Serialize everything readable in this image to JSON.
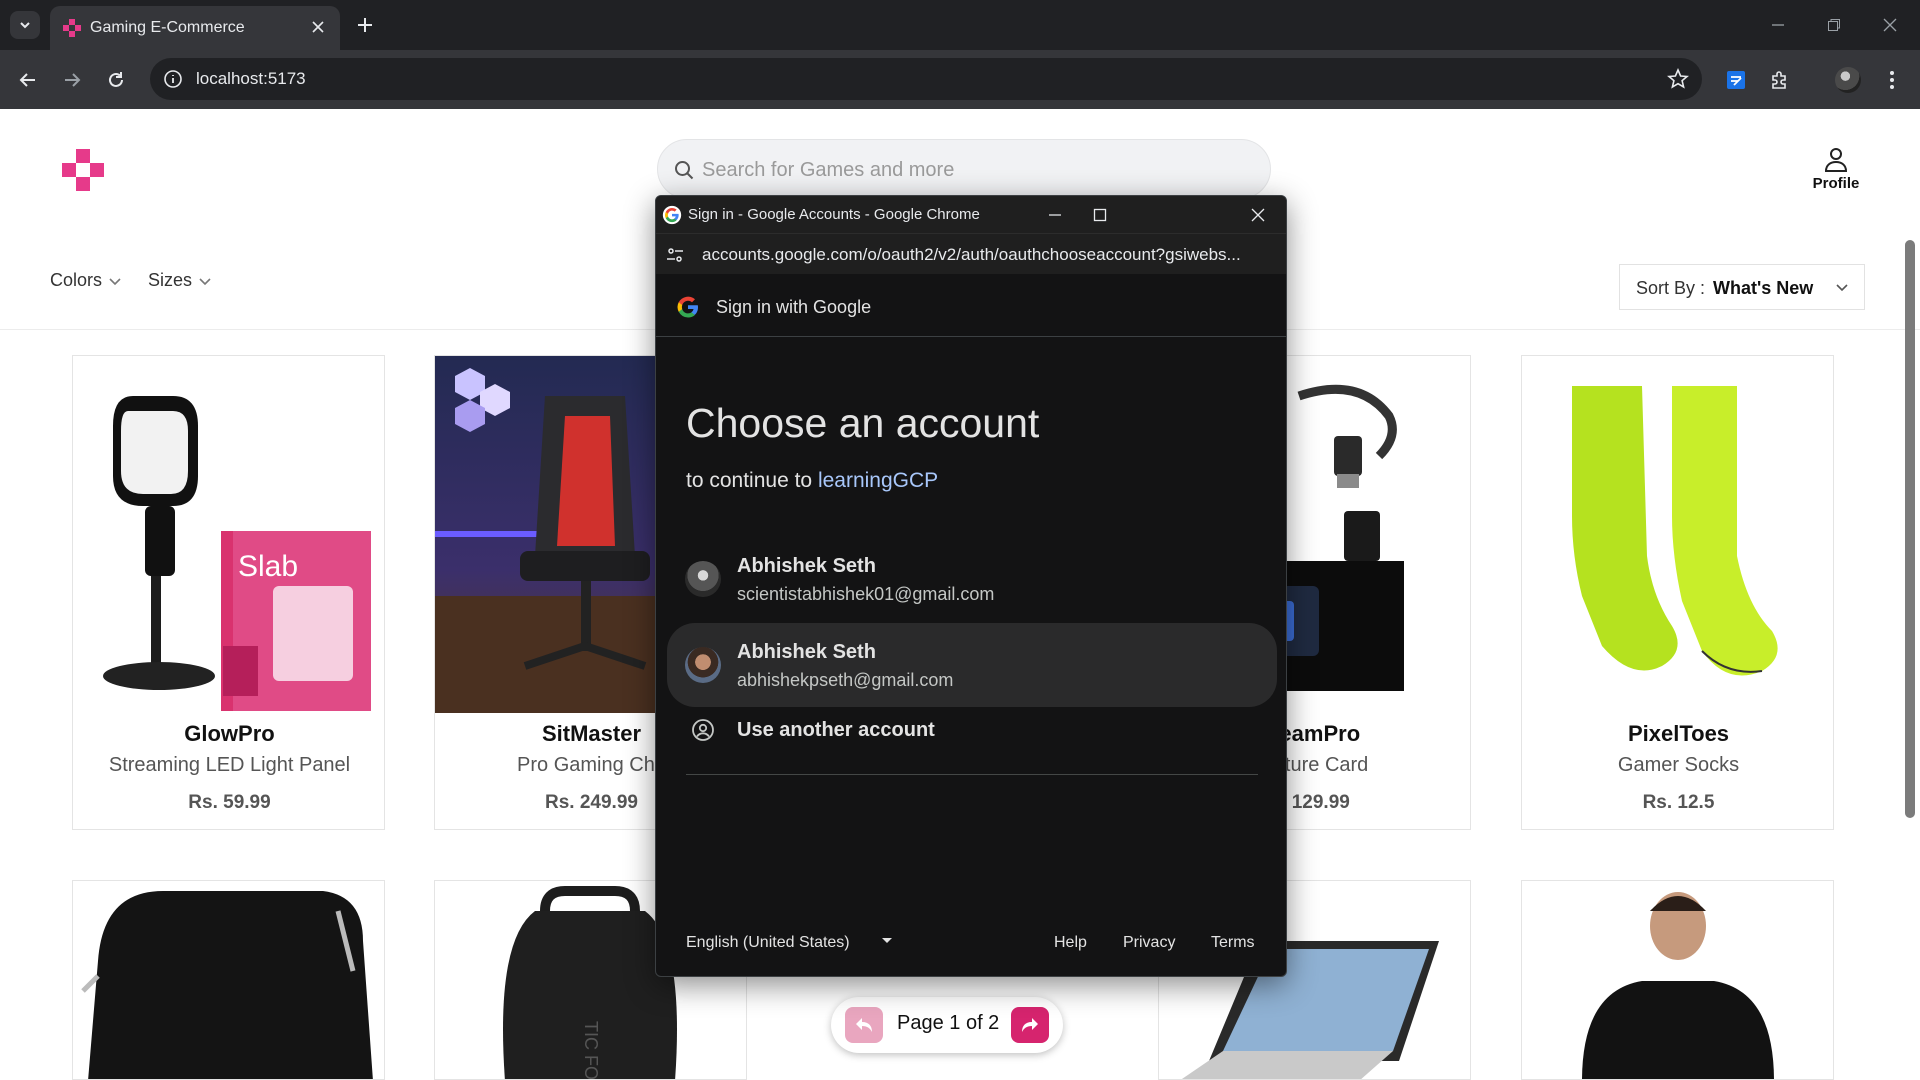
{
  "browser": {
    "tab_title": "Gaming E-Commerce",
    "url": "localhost:5173"
  },
  "site": {
    "search_placeholder": "Search for Games and more",
    "profile_label": "Profile",
    "filters": [
      "Colors",
      "Sizes"
    ],
    "sort_label": "Sort By :",
    "sort_value": "What's New",
    "brand_color": "#e63a8a",
    "products": [
      {
        "name": "GlowPro",
        "subtitle": "Streaming LED Light Panel",
        "price": "Rs. 59.99"
      },
      {
        "name": "SitMaster",
        "subtitle": "Pro Gaming Cha",
        "price": "Rs. 249.99"
      },
      {
        "name": "reamPro",
        "subtitle": "apture Card",
        "price": ". 129.99"
      },
      {
        "name": "PixelToes",
        "subtitle": "Gamer Socks",
        "price": "Rs. 12.5"
      }
    ],
    "pagination": {
      "text": "Page 1 of 2"
    }
  },
  "popup": {
    "window_title": "Sign in - Google Accounts - Google Chrome",
    "url": "accounts.google.com/o/oauth2/v2/auth/oauthchooseaccount?gsiwebs...",
    "header": "Sign in with Google",
    "heading": "Choose an account",
    "continue_prefix": "to continue to",
    "app_name": "learningGCP",
    "accounts": [
      {
        "name": "Abhishek Seth",
        "email": "scientistabhishek01@gmail.com"
      },
      {
        "name": "Abhishek Seth",
        "email": "abhishekpseth@gmail.com"
      }
    ],
    "another_account": "Use another account",
    "language": "English (United States)",
    "footer_links": [
      "Help",
      "Privacy",
      "Terms"
    ]
  }
}
